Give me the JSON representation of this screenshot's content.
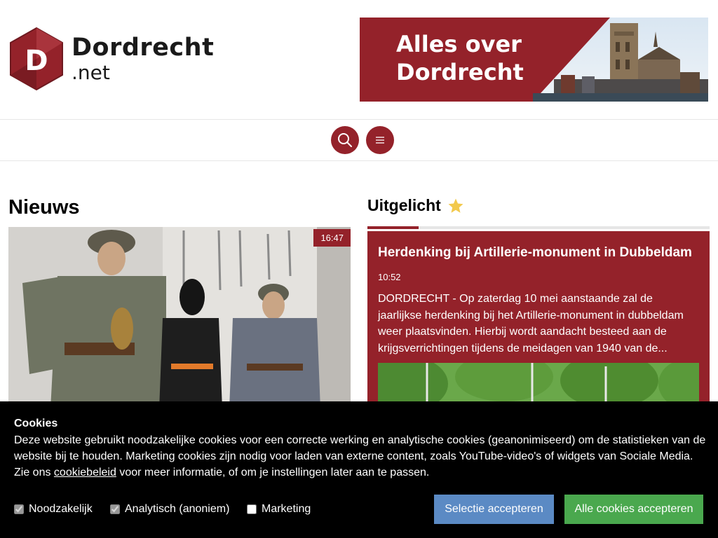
{
  "header": {
    "logo_letter": "D",
    "logo_name": "Dordrecht",
    "logo_tld": ".net",
    "banner_line1": "Alles over",
    "banner_line2": "Dordrecht"
  },
  "nav": {
    "search_icon": "search-icon",
    "menu_icon": "hamburger-icon"
  },
  "news": {
    "title": "Nieuws",
    "card_time": "16:47"
  },
  "featured": {
    "title": "Uitgelicht",
    "title_icon": "star-icon",
    "article_title": "Herdenking bij Artillerie-monument in Dubbeldam",
    "article_time": "10:52",
    "article_excerpt": "DORDRECHT - Op zaterdag 10 mei aanstaande zal de jaarlijkse herdenking bij het Artillerie-monument in dubbeldam weer plaatsvinden. Hierbij wordt aandacht besteed aan de krijgsverrichtingen tijdens de meidagen van 1940 van de..."
  },
  "cookie": {
    "title": "Cookies",
    "text_before_link": "Deze website gebruikt noodzakelijke cookies voor een correcte werking en analytische cookies (geanonimiseerd) om de statistieken van de website bij te houden. Marketing cookies zijn nodig voor laden van externe content, zoals YouTube-video's of widgets van Sociale Media. Zie ons ",
    "link_text": "cookiebeleid",
    "text_after_link": " voor meer informatie, of om je instellingen later aan te passen.",
    "option_necessary": "Noodzakelijk",
    "option_analytics": "Analytisch (anoniem)",
    "option_marketing": "Marketing",
    "button_selection": "Selectie accepteren",
    "button_all": "Alle cookies accepteren"
  },
  "colors": {
    "brand": "#94222a",
    "accept_selection": "#5b8ac4",
    "accept_all": "#4aa84e",
    "star": "#f2c94c"
  }
}
